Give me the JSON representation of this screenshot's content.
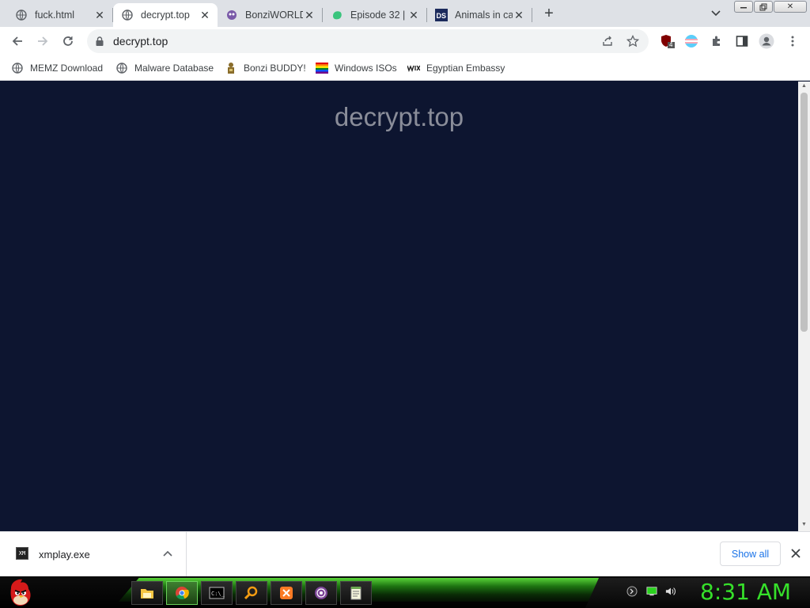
{
  "tabs": [
    {
      "title": "fuck.html",
      "favicon": "globe-icon"
    },
    {
      "title": "decrypt.top",
      "favicon": "globe-icon",
      "active": true
    },
    {
      "title": "BonziWORLD",
      "favicon": "bonzi-icon"
    },
    {
      "title": "Episode 32 |",
      "favicon": "green-blob-icon"
    },
    {
      "title": "Animals in ca",
      "favicon": "ds-icon"
    }
  ],
  "toolbar": {
    "url": "decrypt.top",
    "extension_badge": "4"
  },
  "bookmarks": [
    {
      "label": "MEMZ Download",
      "icon": "globe-icon"
    },
    {
      "label": "Malware Database",
      "icon": "globe-icon"
    },
    {
      "label": "Bonzi BUDDY!",
      "icon": "bonzi-figure-icon"
    },
    {
      "label": "Windows ISOs",
      "icon": "rainbow-flag-icon"
    },
    {
      "label": "Egyptian Embassy",
      "icon": "wix-icon"
    }
  ],
  "page": {
    "site_title": "decrypt.top"
  },
  "download": {
    "filename": "xmplay.exe",
    "icon_text": "XM",
    "show_all": "Show all"
  },
  "taskbar": {
    "clock": "8:31 AM",
    "apps": [
      "file-explorer-icon",
      "chrome-icon",
      "command-prompt-icon",
      "search-app-icon",
      "xampp-icon",
      "tor-icon",
      "notepad-icon"
    ]
  },
  "colors": {
    "page_background": "#0d1530",
    "clock_green": "#36e02a",
    "accent_blue": "#1a73e8"
  }
}
